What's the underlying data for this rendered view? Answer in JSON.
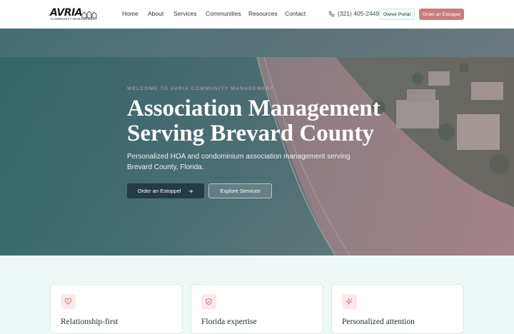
{
  "brand": {
    "logo_text": "AVRIA",
    "logo_subtext": "COMMUNITY MANAGEMENT"
  },
  "nav": {
    "links": [
      "Home",
      "About",
      "Services",
      "Communities",
      "Resources",
      "Contact"
    ],
    "phone": "(321) 405-2449",
    "owner_portal": "Owner Portal",
    "order_estoppel": "Order an Estoppel"
  },
  "hero": {
    "eyebrow": "WELCOME TO AVRIA COMMUNITY MANAGEMENT",
    "headline_line1": "Association Management",
    "headline_line2": "Serving Brevard County",
    "subtitle": "Personalized HOA and condominium association management serving Brevard County, Florida.",
    "primary_button": "Order an Estoppel",
    "secondary_button": "Explore Services"
  },
  "features": {
    "cards": [
      {
        "title": "Relationship-first",
        "icon": "heart-icon"
      },
      {
        "title": "Florida expertise",
        "icon": "shield-check-icon"
      },
      {
        "title": "Personalized attention",
        "icon": "sparkle-icon"
      }
    ]
  },
  "colors": {
    "accent": "#c97b7d",
    "dark_teal": "#223c44",
    "background": "#eef8f7"
  }
}
